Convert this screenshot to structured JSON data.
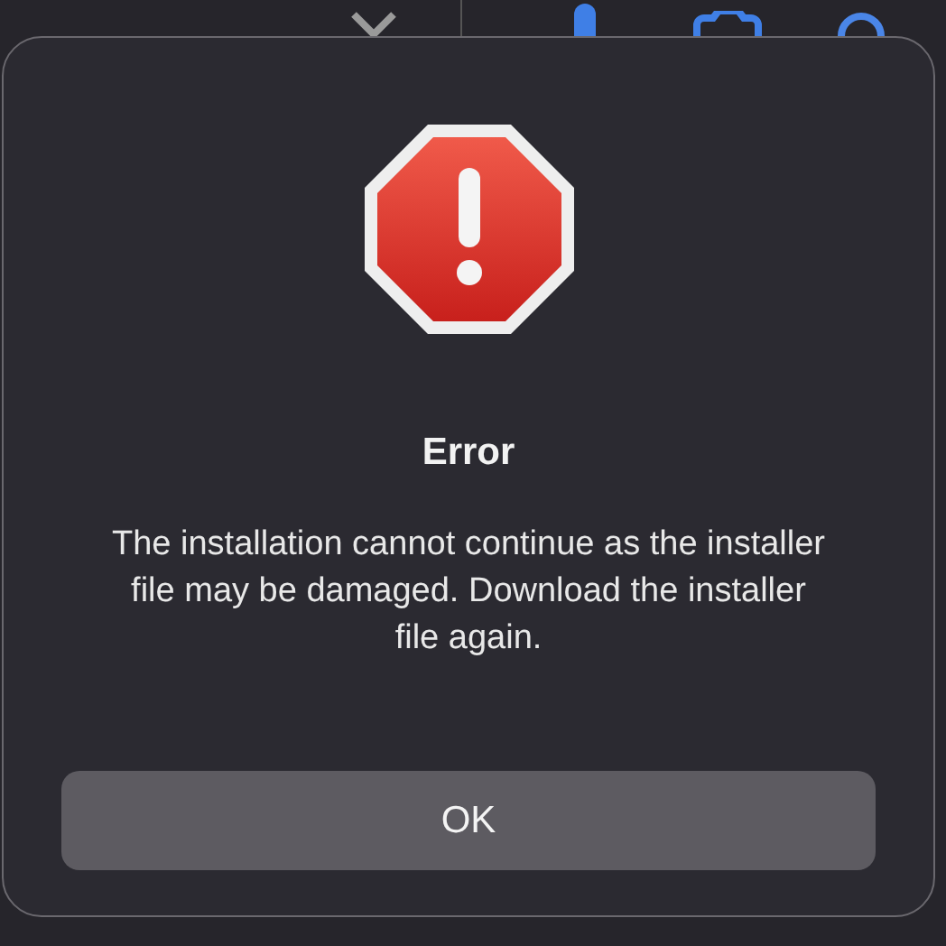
{
  "alert": {
    "title": "Error",
    "message": "The installation cannot continue as the installer file may be damaged. Download the installer file again.",
    "buttons": [
      "OK"
    ]
  }
}
